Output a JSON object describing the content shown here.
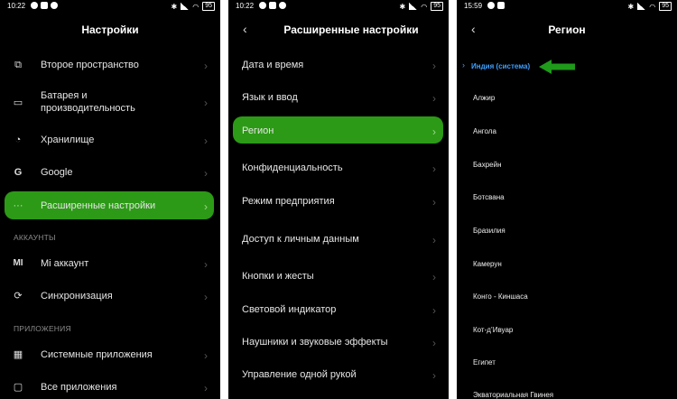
{
  "screen1": {
    "time": "10:22",
    "battery": "95",
    "title": "Настройки",
    "items": [
      {
        "label": "Второе пространство"
      },
      {
        "label1": "Батарея и",
        "label2": "производительность"
      },
      {
        "label": "Хранилище"
      },
      {
        "label": "Google"
      },
      {
        "label": "Расширенные настройки"
      },
      {
        "label": "Mi аккаунт"
      },
      {
        "label": "Синхронизация"
      },
      {
        "label": "Системные приложения"
      },
      {
        "label": "Все приложения"
      }
    ],
    "sections": [
      "АККАУНТЫ",
      "ПРИЛОЖЕНИЯ"
    ]
  },
  "screen2": {
    "time": "10:22",
    "battery": "95",
    "title": "Расширенные настройки",
    "items": [
      "Дата и время",
      "Язык и ввод",
      "Регион",
      "Конфиденциальность",
      "Режим предприятия",
      "Доступ к личным данным",
      "Кнопки и жесты",
      "Световой индикатор",
      "Наушники и звуковые эффекты",
      "Управление одной рукой"
    ]
  },
  "screen3": {
    "time": "15:59",
    "battery": "95",
    "title": "Регион",
    "selected": "Индия (система)",
    "regions": [
      "Алжир",
      "Ангола",
      "Бахрейн",
      "Ботсвана",
      "Бразилия",
      "Камерун",
      "Конго - Киншаса",
      "Кот-д’Ивуар",
      "Египет",
      "Экваториальная Гвинея"
    ]
  },
  "colors": {
    "highlight": "#2c9a16",
    "selected_text": "#3fa0ff",
    "background": "#000000"
  }
}
